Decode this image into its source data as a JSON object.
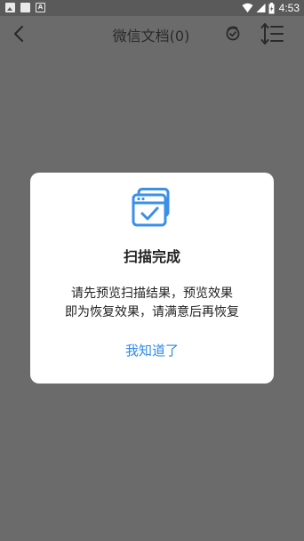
{
  "status_bar": {
    "time": "4:53",
    "left_icons": [
      "photo-icon",
      "square-icon",
      "a-box-icon"
    ],
    "right_icons": [
      "wifi-icon",
      "signal-icon",
      "battery-icon"
    ]
  },
  "nav": {
    "title": "微信文档(0)",
    "back_icon": "chevron-left-icon",
    "action_icons": [
      "deleted-check-icon",
      "sort-icon"
    ]
  },
  "dialog": {
    "icon": "scan-complete-icon",
    "title": "扫描完成",
    "message_lines": [
      "请先预览扫描结果，预览效果",
      "即为恢复效果，请满意后再恢复"
    ],
    "confirm_label": "我知道了"
  },
  "colors": {
    "overlay": "#6b6b6b",
    "status_bar": "#5a5a5a",
    "dialog_bg": "#ffffff",
    "accent": "#2f8ae6",
    "icon_blue": "#3b8fe8"
  }
}
